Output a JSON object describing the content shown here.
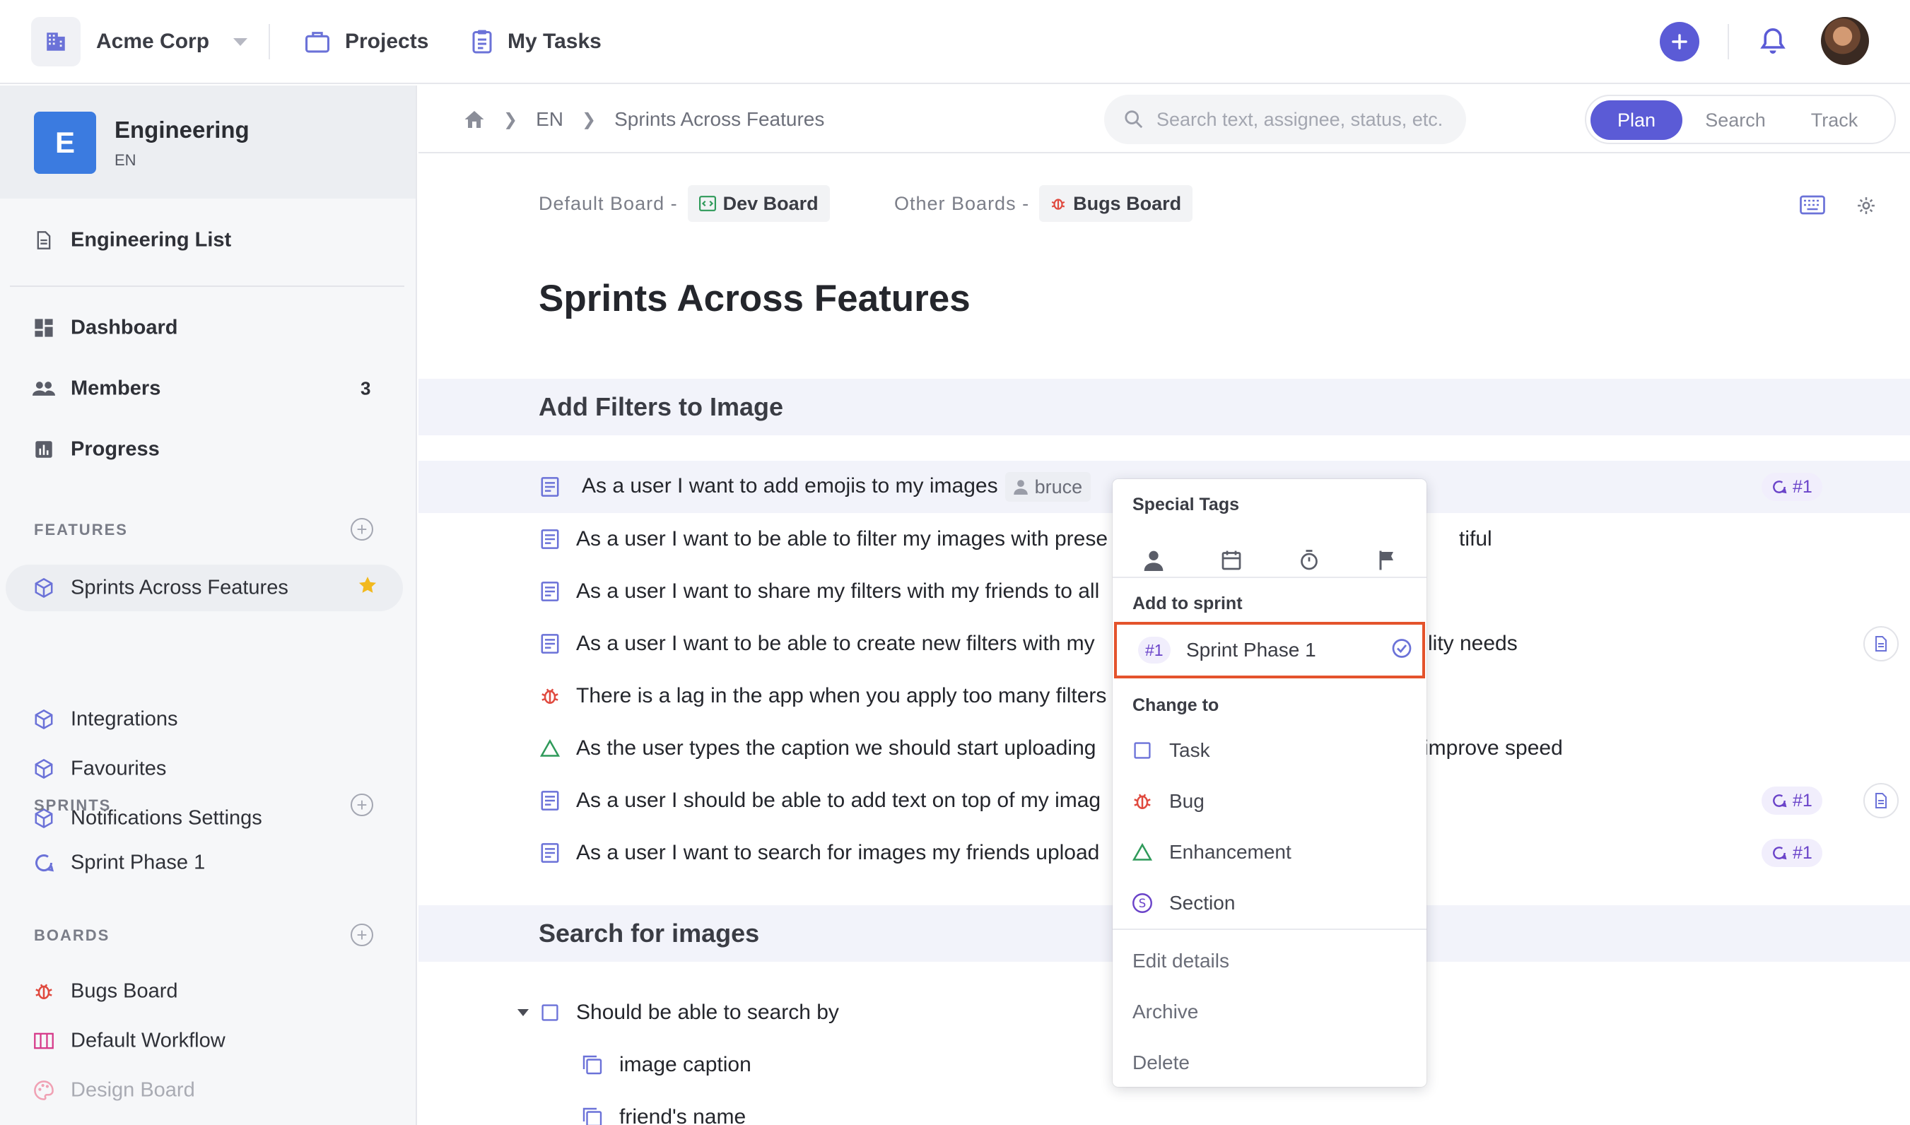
{
  "topbar": {
    "org_name": "Acme Corp",
    "nav": [
      {
        "label": "Projects"
      },
      {
        "label": "My Tasks"
      }
    ],
    "accent": "#5b5bd6"
  },
  "sidebar": {
    "team": {
      "initial": "E",
      "name": "Engineering",
      "code": "EN"
    },
    "list_item": "Engineering List",
    "items": [
      {
        "label": "Dashboard"
      },
      {
        "label": "Members",
        "count": "3"
      },
      {
        "label": "Progress"
      }
    ],
    "features": {
      "heading": "FEATURES",
      "items": [
        {
          "label": "Sprints Across Features",
          "starred": true
        },
        {
          "label": "Integrations"
        },
        {
          "label": "Favourites"
        },
        {
          "label": "Notifications Settings"
        }
      ]
    },
    "sprints": {
      "heading": "SPRINTS",
      "items": [
        {
          "label": "Sprint Phase 1"
        }
      ]
    },
    "boards": {
      "heading": "BOARDS",
      "items": [
        {
          "label": "Bugs Board"
        },
        {
          "label": "Default Workflow"
        },
        {
          "label": "Design Board"
        }
      ]
    }
  },
  "header": {
    "breadcrumb": [
      "EN",
      "Sprints Across Features"
    ],
    "search_placeholder": "Search text, assignee, status, etc.",
    "modes": [
      "Plan",
      "Search",
      "Track"
    ],
    "active_mode": "Plan"
  },
  "boards": {
    "default_label": "Default Board -",
    "default_board": "Dev Board",
    "other_label": "Other Boards -",
    "other_board": "Bugs Board"
  },
  "page_title": "Sprints Across Features",
  "sections": [
    {
      "title": "Add Filters to Image",
      "rows": [
        {
          "type": "story",
          "text": "As a user I want to add emojis to my images",
          "assignee": "bruce",
          "sprint": "#1"
        },
        {
          "type": "story",
          "text": "As a user I want to be able to filter my images with prese",
          "tail": "tiful"
        },
        {
          "type": "story",
          "text": "As a user I want to share my filters with my friends to all"
        },
        {
          "type": "story",
          "text": "As a user I want to be able to create new filters with my",
          "tail": "lity needs",
          "doc": true
        },
        {
          "type": "bug",
          "text": "There is a lag in the app when you apply too many filters"
        },
        {
          "type": "enhancement",
          "text": "As the user types the caption we should start uploading",
          "tail": "improve speed"
        },
        {
          "type": "story",
          "text": "As a user I should be able to add text on top of my imag",
          "sprint": "#1",
          "doc": true
        },
        {
          "type": "story",
          "text": "As a user I want to search for images my friends upload",
          "sprint": "#1"
        }
      ]
    },
    {
      "title": "Search for images",
      "rows": [
        {
          "type": "task",
          "text": "Should be able to search by",
          "expanded": true
        },
        {
          "type": "subtask",
          "text": "image caption"
        },
        {
          "type": "subtask",
          "text": "friend's name"
        }
      ]
    }
  ],
  "context_menu": {
    "special_tags_heading": "Special Tags",
    "special_tags": [
      "person-icon",
      "calendar-icon",
      "stopwatch-icon",
      "flag-icon"
    ],
    "add_to_sprint_heading": "Add to sprint",
    "sprint_option": {
      "number": "#1",
      "name": "Sprint Phase 1",
      "selected": true
    },
    "change_to_heading": "Change to",
    "change_to": [
      {
        "label": "Task",
        "icon": "checkbox-icon"
      },
      {
        "label": "Bug",
        "icon": "bug-icon"
      },
      {
        "label": "Enhancement",
        "icon": "triangle-icon"
      },
      {
        "label": "Section",
        "icon": "section-icon"
      }
    ],
    "actions": [
      "Edit details",
      "Archive",
      "Delete"
    ],
    "highlight_color": "#e4532c"
  }
}
